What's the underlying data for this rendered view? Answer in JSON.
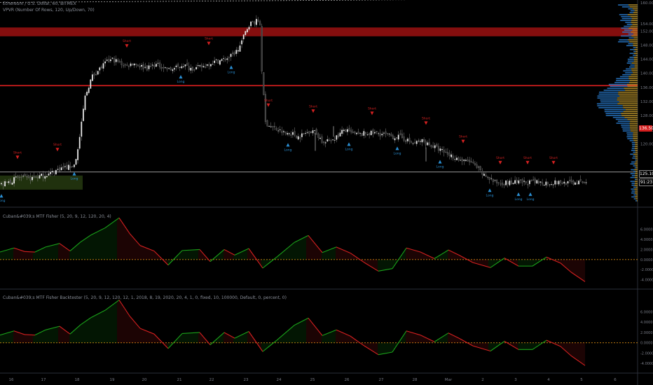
{
  "header": {
    "symbol_line": "Ethereum / U.S. Dollar, 60, BITMEX",
    "indicator_line": "VPVR (Number Of Rows, 120, Up/Down, 70)"
  },
  "pane2": {
    "legend": "Cuban&#039;s MTF Fisher (5, 20, 9, 12, 120, 20, 4)"
  },
  "pane3": {
    "legend": "Cuban&#039;s MTF Fisher Backtester (5, 20, 9, 12, 120, 12, 1, 2018, 8, 19, 2020, 20, 4, 1, 0, fixed, 10, 100000, Default, 0, percent, 0)"
  },
  "price_tags": {
    "red": "136.50",
    "white1": "125.10",
    "white2": "91:23"
  },
  "colors": {
    "bull": "#e8e8e8",
    "bear": "#3a3a3a",
    "fisher_up": "#1aa31a",
    "fisher_down": "#d42020",
    "zero_line": "#d98c12",
    "resistance": "#8b0f0f",
    "support_zone": "#3a5a1a",
    "vol_up": "#2a7fd4",
    "vol_down": "#c9a030",
    "short": "#d42020",
    "long": "#2a8fd4"
  },
  "chart_data": [
    {
      "type": "candlestick",
      "title": "Ethereum / U.S. Dollar, 60, BITMEX",
      "ylim": [
        104,
        160
      ],
      "y_ticks": [
        "160.00",
        "154.00",
        "152.00",
        "148.00",
        "144.00",
        "140.00",
        "136.00",
        "132.00",
        "128.00",
        "124.00",
        "120.00"
      ],
      "path": [
        [
          0,
          108.4
        ],
        [
          10,
          109
        ],
        [
          25,
          110.5
        ],
        [
          40,
          110
        ],
        [
          55,
          110.8
        ],
        [
          70,
          111.5
        ],
        [
          85,
          113
        ],
        [
          100,
          113.5
        ],
        [
          105,
          114
        ],
        [
          110,
          118
        ],
        [
          115,
          125
        ],
        [
          120,
          133
        ],
        [
          130,
          139
        ],
        [
          140,
          141
        ],
        [
          150,
          143
        ],
        [
          160,
          144
        ],
        [
          170,
          143
        ],
        [
          180,
          142
        ],
        [
          190,
          143
        ],
        [
          200,
          142
        ],
        [
          210,
          141.5
        ],
        [
          220,
          142.5
        ],
        [
          230,
          142
        ],
        [
          240,
          141
        ],
        [
          250,
          141.5
        ],
        [
          260,
          142.5
        ],
        [
          270,
          141.5
        ],
        [
          280,
          141.5
        ],
        [
          290,
          142
        ],
        [
          300,
          143
        ],
        [
          310,
          143.5
        ],
        [
          320,
          144
        ],
        [
          330,
          145
        ],
        [
          340,
          147
        ],
        [
          350,
          152
        ],
        [
          355,
          154
        ],
        [
          360,
          154.5
        ],
        [
          370,
          155
        ],
        [
          373,
          140
        ],
        [
          378,
          126
        ],
        [
          385,
          125
        ],
        [
          395,
          124
        ],
        [
          405,
          123
        ],
        [
          415,
          123
        ],
        [
          425,
          122
        ],
        [
          435,
          123
        ],
        [
          445,
          124
        ],
        [
          455,
          122
        ],
        [
          460,
          120
        ],
        [
          470,
          121
        ],
        [
          480,
          122
        ],
        [
          490,
          124
        ],
        [
          500,
          123
        ],
        [
          510,
          122.5
        ],
        [
          520,
          123
        ],
        [
          530,
          123
        ],
        [
          540,
          123
        ],
        [
          550,
          122.5
        ],
        [
          560,
          122
        ],
        [
          570,
          122
        ],
        [
          580,
          121
        ],
        [
          590,
          120
        ],
        [
          600,
          121
        ],
        [
          610,
          120
        ],
        [
          620,
          119
        ],
        [
          630,
          118
        ],
        [
          640,
          117
        ],
        [
          650,
          116
        ],
        [
          660,
          115
        ],
        [
          670,
          115
        ],
        [
          680,
          113
        ],
        [
          690,
          111
        ],
        [
          700,
          110
        ],
        [
          705,
          109
        ]
      ],
      "markers": [
        {
          "kind": "short",
          "label": "Short",
          "i": 25
        },
        {
          "kind": "long",
          "label": "Long",
          "i": 2
        },
        {
          "kind": "short",
          "label": "Short",
          "i": 82
        },
        {
          "kind": "long",
          "label": "Long",
          "i": 106
        },
        {
          "kind": "short",
          "label": "Short",
          "i": 181
        },
        {
          "kind": "long",
          "label": "Long",
          "i": 258
        },
        {
          "kind": "short",
          "label": "Short",
          "i": 298
        },
        {
          "kind": "long",
          "label": "Long",
          "i": 330
        },
        {
          "kind": "short",
          "label": "Short",
          "i": 383
        },
        {
          "kind": "long",
          "label": "Long",
          "i": 411
        },
        {
          "kind": "short",
          "label": "Short",
          "i": 447
        },
        {
          "kind": "long",
          "label": "Long",
          "i": 498
        },
        {
          "kind": "short",
          "label": "Short",
          "i": 531
        },
        {
          "kind": "long",
          "label": "Long",
          "i": 567
        },
        {
          "kind": "short",
          "label": "Short",
          "i": 608
        },
        {
          "kind": "long",
          "label": "Long",
          "i": 628
        },
        {
          "kind": "short",
          "label": "Short",
          "i": 661
        },
        {
          "kind": "long",
          "label": "Long",
          "i": 699
        },
        {
          "kind": "short",
          "label": "Short",
          "i": 714
        },
        {
          "kind": "long",
          "label": "Long",
          "i": 740
        },
        {
          "kind": "short",
          "label": "Short",
          "i": 753
        },
        {
          "kind": "long",
          "label": "Long",
          "i": 757
        },
        {
          "kind": "short",
          "label": "Short",
          "i": 790
        }
      ],
      "levels": {
        "resistance_zone": [
          150.5,
          153
        ],
        "red_line": 136.5,
        "support_zone": [
          107,
          111
        ],
        "white_line": 112,
        "dotted_top": 160.5
      }
    },
    {
      "type": "line",
      "name": "Cuban&#039;s MTF Fisher",
      "ylim": [
        -5.6,
        10
      ],
      "y_ticks": [
        "6.0000",
        "4.0000",
        "2.0000",
        "0.0000",
        "-2.0000",
        "-4.0000"
      ],
      "zero": 0,
      "path": [
        [
          0,
          1.5
        ],
        [
          20,
          2.3
        ],
        [
          35,
          1.6
        ],
        [
          50,
          1.5
        ],
        [
          65,
          2.5
        ],
        [
          85,
          3.2
        ],
        [
          100,
          1.7
        ],
        [
          115,
          3.5
        ],
        [
          130,
          4.9
        ],
        [
          150,
          6.3
        ],
        [
          170,
          8.3
        ],
        [
          185,
          5.2
        ],
        [
          200,
          2.8
        ],
        [
          220,
          1.7
        ],
        [
          240,
          -1.1
        ],
        [
          260,
          1.8
        ],
        [
          285,
          2
        ],
        [
          300,
          -0.4
        ],
        [
          320,
          2
        ],
        [
          335,
          0.9
        ],
        [
          355,
          2.2
        ],
        [
          375,
          -1.7
        ],
        [
          395,
          0.5
        ],
        [
          420,
          3.4
        ],
        [
          440,
          4.8
        ],
        [
          460,
          1.4
        ],
        [
          480,
          2.5
        ],
        [
          500,
          1.3
        ],
        [
          520,
          -0.6
        ],
        [
          540,
          -2.3
        ],
        [
          560,
          -1.8
        ],
        [
          580,
          2.3
        ],
        [
          600,
          1.5
        ],
        [
          620,
          0.2
        ],
        [
          640,
          1.9
        ],
        [
          655,
          0.9
        ],
        [
          675,
          -0.6
        ],
        [
          700,
          -1.6
        ],
        [
          720,
          0.3
        ],
        [
          740,
          -1.3
        ],
        [
          760,
          -1.3
        ],
        [
          780,
          0.5
        ],
        [
          800,
          -0.7
        ],
        [
          815,
          -2.5
        ],
        [
          835,
          -4.4
        ]
      ]
    },
    {
      "type": "line",
      "name": "Cuban&#039;s MTF Fisher Backtester",
      "ylim": [
        -5.6,
        10
      ],
      "y_ticks": [
        "6.0000",
        "4.0000",
        "2.0000",
        "0.0000",
        "-2.0000",
        "-4.0000"
      ],
      "zero": 0,
      "path": [
        [
          0,
          1.5
        ],
        [
          20,
          2.3
        ],
        [
          35,
          1.6
        ],
        [
          50,
          1.5
        ],
        [
          65,
          2.5
        ],
        [
          85,
          3.2
        ],
        [
          100,
          1.7
        ],
        [
          115,
          3.5
        ],
        [
          130,
          4.9
        ],
        [
          150,
          6.3
        ],
        [
          170,
          8.3
        ],
        [
          185,
          5.2
        ],
        [
          200,
          2.8
        ],
        [
          220,
          1.7
        ],
        [
          240,
          -1.1
        ],
        [
          260,
          1.8
        ],
        [
          285,
          2
        ],
        [
          300,
          -0.4
        ],
        [
          320,
          2
        ],
        [
          335,
          0.9
        ],
        [
          355,
          2.2
        ],
        [
          375,
          -1.7
        ],
        [
          395,
          0.5
        ],
        [
          420,
          3.4
        ],
        [
          440,
          4.8
        ],
        [
          460,
          1.4
        ],
        [
          480,
          2.5
        ],
        [
          500,
          1.3
        ],
        [
          520,
          -0.6
        ],
        [
          540,
          -2.3
        ],
        [
          560,
          -1.8
        ],
        [
          580,
          2.3
        ],
        [
          600,
          1.5
        ],
        [
          620,
          0.2
        ],
        [
          640,
          1.9
        ],
        [
          655,
          0.9
        ],
        [
          675,
          -0.6
        ],
        [
          700,
          -1.6
        ],
        [
          720,
          0.3
        ],
        [
          740,
          -1.3
        ],
        [
          760,
          -1.3
        ],
        [
          780,
          0.5
        ],
        [
          800,
          -0.7
        ],
        [
          815,
          -2.5
        ],
        [
          835,
          -4.4
        ]
      ]
    }
  ],
  "x_axis_labels": [
    "16",
    "17",
    "18",
    "19",
    "20",
    "21",
    "22",
    "23",
    "24",
    "25",
    "26",
    "27",
    "28",
    "Mar",
    "2",
    "3",
    "4",
    "5",
    "6"
  ]
}
